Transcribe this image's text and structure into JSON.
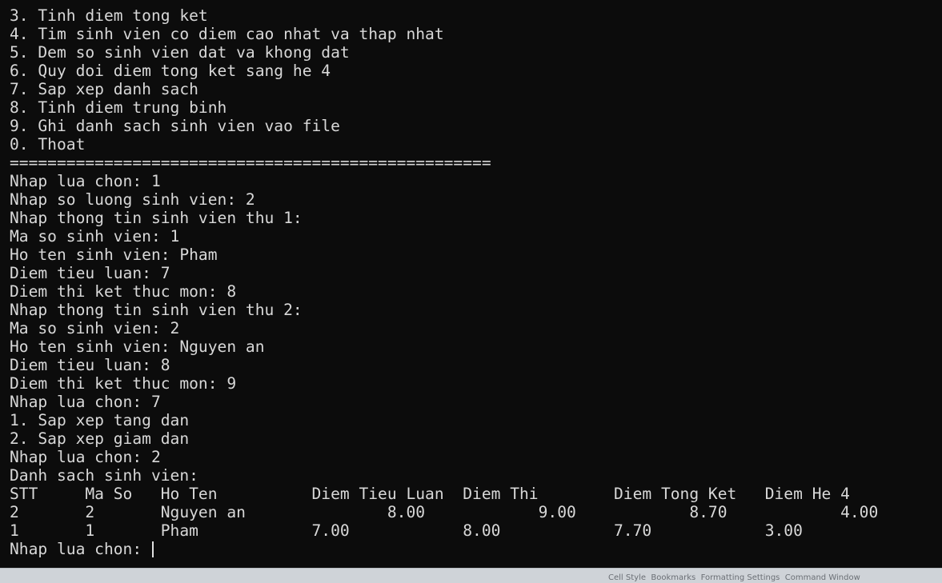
{
  "terminal": {
    "lines": [
      "3. Tinh diem tong ket",
      "4. Tim sinh vien co diem cao nhat va thap nhat",
      "5. Dem so sinh vien dat va khong dat",
      "6. Quy doi diem tong ket sang he 4",
      "7. Sap xep danh sach",
      "8. Tinh diem trung binh",
      "9. Ghi danh sach sinh vien vao file",
      "0. Thoat",
      "===================================================",
      "Nhap lua chon: 1",
      "Nhap so luong sinh vien: 2",
      "Nhap thong tin sinh vien thu 1:",
      "Ma so sinh vien: 1",
      "Ho ten sinh vien: Pham",
      "Diem tieu luan: 7",
      "Diem thi ket thuc mon: 8",
      "Nhap thong tin sinh vien thu 2:",
      "Ma so sinh vien: 2",
      "Ho ten sinh vien: Nguyen an",
      "Diem tieu luan: 8",
      "Diem thi ket thuc mon: 9",
      "Nhap lua chon: 7",
      "1. Sap xep tang dan",
      "2. Sap xep giam dan",
      "Nhap lua chon: 2",
      "Danh sach sinh vien:",
      "STT     Ma So   Ho Ten          Diem Tieu Luan  Diem Thi        Diem Tong Ket   Diem He 4",
      "2       2       Nguyen an               8.00            9.00            8.70            4.00",
      "1       1       Pham            7.00            8.00            7.70            3.00"
    ],
    "prompt": "Nhap lua chon: "
  },
  "taskbar": {
    "text": "Cell Style  Bookmarks  Formatting Settings  Command Window"
  }
}
